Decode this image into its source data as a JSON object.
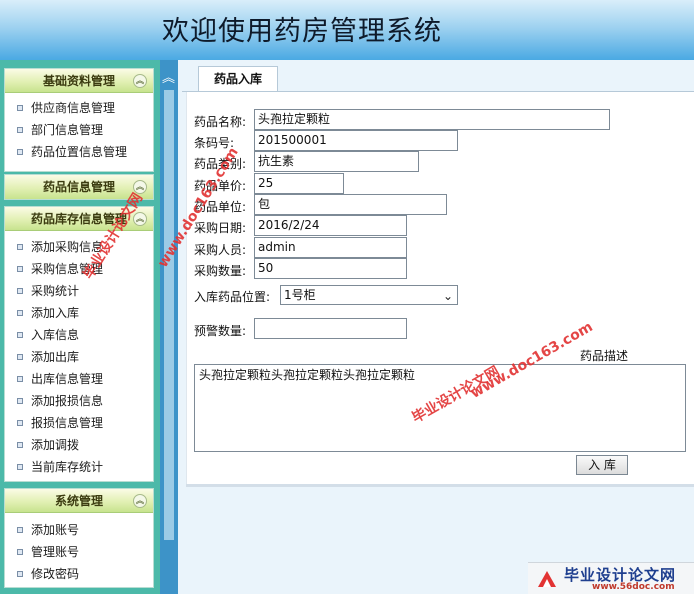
{
  "header": {
    "title": "欢迎使用药房管理系统"
  },
  "sidebar": {
    "toggle_glyph": "︽",
    "groups": [
      {
        "title": "基础资料管理",
        "items": [
          "供应商信息管理",
          "部门信息管理",
          "药品位置信息管理"
        ]
      },
      {
        "title": "药品信息管理",
        "items": []
      },
      {
        "title": "药品库存信息管理",
        "items": [
          "添加采购信息",
          "采购信息管理",
          "采购统计",
          "添加入库",
          "入库信息",
          "添加出库",
          "出库信息管理",
          "添加报损信息",
          "报损信息管理",
          "添加调拨",
          "当前库存统计"
        ]
      },
      {
        "title": "系统管理",
        "items": [
          "添加账号",
          "管理账号",
          "修改密码"
        ]
      }
    ]
  },
  "scroll": {
    "up_glyph": "︽"
  },
  "main": {
    "tab_label": "药品入库",
    "form": {
      "name_label": "药品名称:",
      "name_value": "头孢拉定颗粒",
      "barcode_label": "条码号:",
      "barcode_value": "201500001",
      "category_label": "药品类别:",
      "category_value": "抗生素",
      "price_label": "药品单价:",
      "price_value": "25",
      "unit_label": "药品单位:",
      "unit_value": "包",
      "date_label": "采购日期:",
      "date_value": "2016/2/24",
      "buyer_label": "采购人员:",
      "buyer_value": "admin",
      "qty_label": "采购数量:",
      "qty_value": "50",
      "location_label": "入库药品位置:",
      "location_value": "1号柜",
      "warn_label": "预警数量:",
      "warn_value": "",
      "desc_label": "药品描述",
      "desc_value": "头孢拉定颗粒头孢拉定颗粒头孢拉定颗粒",
      "submit_label": "入 库"
    }
  },
  "watermarks": {
    "cn": "毕业设计论文网",
    "url": "www.doc163.com"
  },
  "logo": {
    "title": "毕业设计论文网",
    "url": "www.56doc.com"
  },
  "colors": {
    "sidebar_bg": "#4cb9a9",
    "header_bottom": "#4aa9e3",
    "watermark": "#e23333"
  }
}
